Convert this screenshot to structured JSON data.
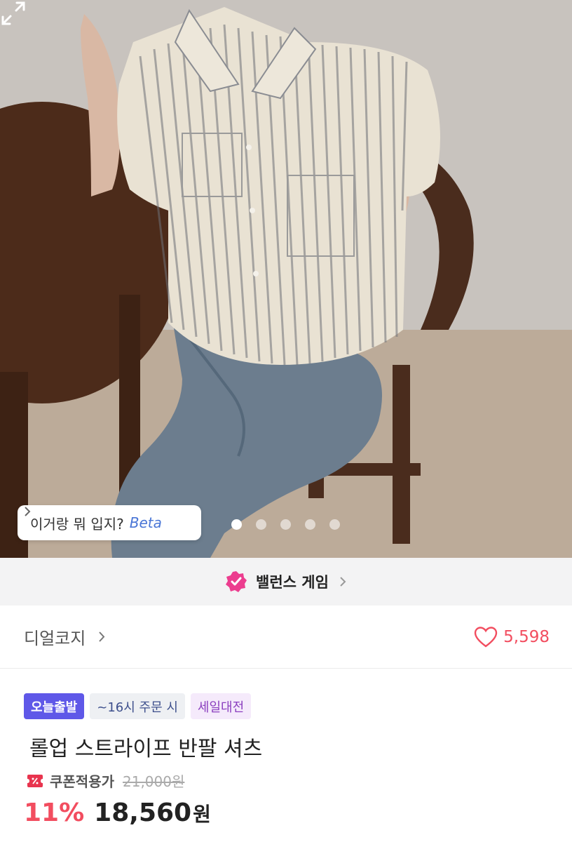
{
  "hero": {
    "wear_prompt": {
      "question": "이거랑 뭐 입지?",
      "beta": "Beta"
    },
    "carousel": {
      "total": 5,
      "current": 1
    },
    "expand_icon": "expand-icon"
  },
  "banner": {
    "label": "밸런스 게임",
    "icon": "check-badge-icon",
    "color": "#ec3d8f"
  },
  "brand": {
    "name": "디얼코지",
    "likes": "5,598",
    "like_color": "#f24d5f"
  },
  "product": {
    "tags": [
      {
        "label": "오늘출발",
        "kind": "today"
      },
      {
        "label": "~16시 주문 시",
        "kind": "time"
      },
      {
        "label": "세일대전",
        "kind": "sale"
      }
    ],
    "title": "롤업 스트라이프 반팔 셔츠",
    "coupon_label": "쿠폰적용가",
    "original_price": "21,000원",
    "discount": "11%",
    "price": "18,560",
    "currency": "원"
  }
}
